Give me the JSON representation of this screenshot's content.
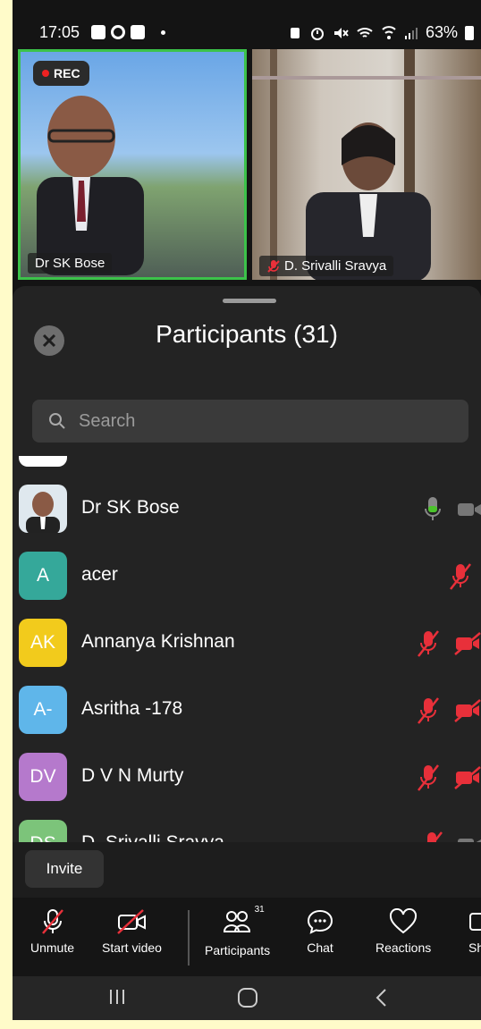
{
  "status_bar": {
    "time": "17:05",
    "battery": "63%"
  },
  "video": {
    "rec_label": "REC",
    "tile1_name": "Dr SK Bose",
    "tile2_name": "D. Srivalli Sravya"
  },
  "participants_panel": {
    "title": "Participants (31)",
    "search_placeholder": "Search",
    "participants": [
      {
        "initials": "",
        "name": "Dr SK Bose",
        "avatar_color": "#dfe8ee",
        "mic": "on",
        "video": "on"
      },
      {
        "initials": "A",
        "name": "acer",
        "avatar_color": "#35a89a",
        "mic": "muted",
        "video": "none"
      },
      {
        "initials": "AK",
        "name": "Annanya Krishnan",
        "avatar_color": "#f2cb1c",
        "mic": "muted",
        "video": "off"
      },
      {
        "initials": "A-",
        "name": "Asritha -178",
        "avatar_color": "#5fb6ea",
        "mic": "muted",
        "video": "off"
      },
      {
        "initials": "DV",
        "name": "D V N Murty",
        "avatar_color": "#b579cc",
        "mic": "muted",
        "video": "off"
      },
      {
        "initials": "DS",
        "name": "D. Srivalli Sravya",
        "avatar_color": "#7cc47a",
        "mic": "muted",
        "video": "on"
      }
    ],
    "invite_label": "Invite"
  },
  "toolbar": {
    "unmute": "Unmute",
    "start_video": "Start video",
    "participants": "Participants",
    "participants_count": "31",
    "chat": "Chat",
    "reactions": "Reactions",
    "share": "Sh"
  },
  "colors": {
    "accent_green": "#3cc24a",
    "muted_red": "#e8303a",
    "mic_green": "#4cc42c"
  }
}
